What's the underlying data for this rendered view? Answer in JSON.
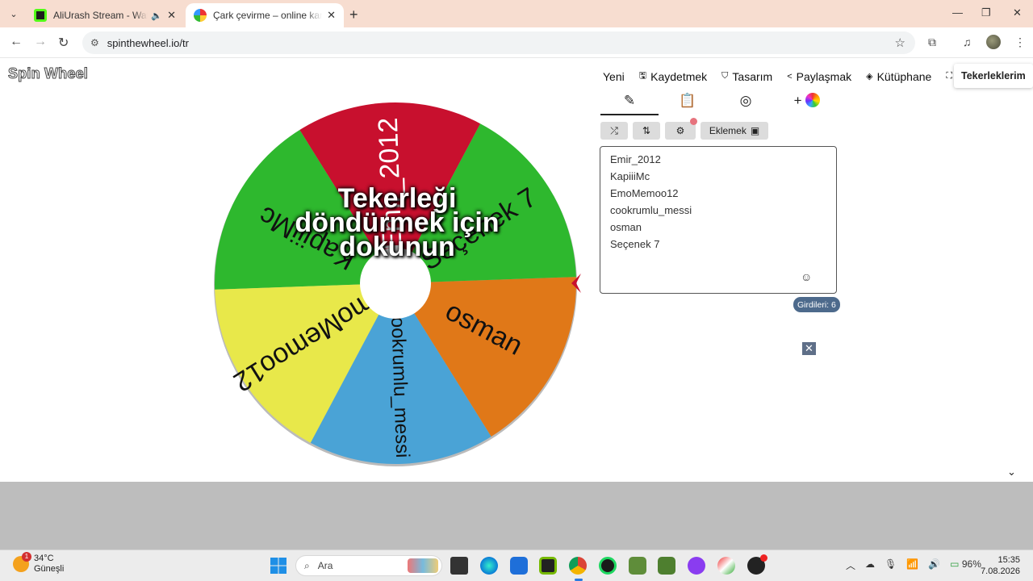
{
  "browser": {
    "tabs": [
      {
        "title": "AliUrash Stream - Watch Liv",
        "active": false
      },
      {
        "title": "Çark çevirme – online karar çark",
        "active": true
      }
    ],
    "url": "spinthewheel.io/tr"
  },
  "site": {
    "logo": "Spin Wheel",
    "nav": [
      "Yeni",
      "Kaydetmek",
      "Tasarım",
      "Paylaşmak",
      "Kütüphane"
    ],
    "wheels_button": "Tekerleklerim"
  },
  "wheel": {
    "overlay_text": [
      "Tekerleği",
      "döndürmek için",
      "dokunun"
    ],
    "segments": [
      {
        "label": "Emir_2012",
        "color": "#c8102e"
      },
      {
        "label": "KapiiiMc",
        "color": "#2eb82e"
      },
      {
        "label": "EmoMemoo12",
        "color": "#e8e84a"
      },
      {
        "label": "cookrumlu_messi",
        "color": "#4aa3d6"
      },
      {
        "label": "osman",
        "color": "#e07818"
      },
      {
        "label": "Seçenek 7",
        "color": "#2eb82e"
      }
    ]
  },
  "editor": {
    "add_label": "Eklemek",
    "entries": [
      "Emir_2012",
      "KapiiiMc",
      "EmoMemoo12",
      "cookrumlu_messi",
      "osman",
      "Seçenek 7"
    ],
    "count_label": "Girdileri: 6"
  },
  "taskbar": {
    "weather_temp": "34°C",
    "weather_desc": "Güneşli",
    "weather_badge": "1",
    "search_placeholder": "Ara",
    "battery": "96%",
    "time": "15:35",
    "date": "7.08.2026"
  }
}
